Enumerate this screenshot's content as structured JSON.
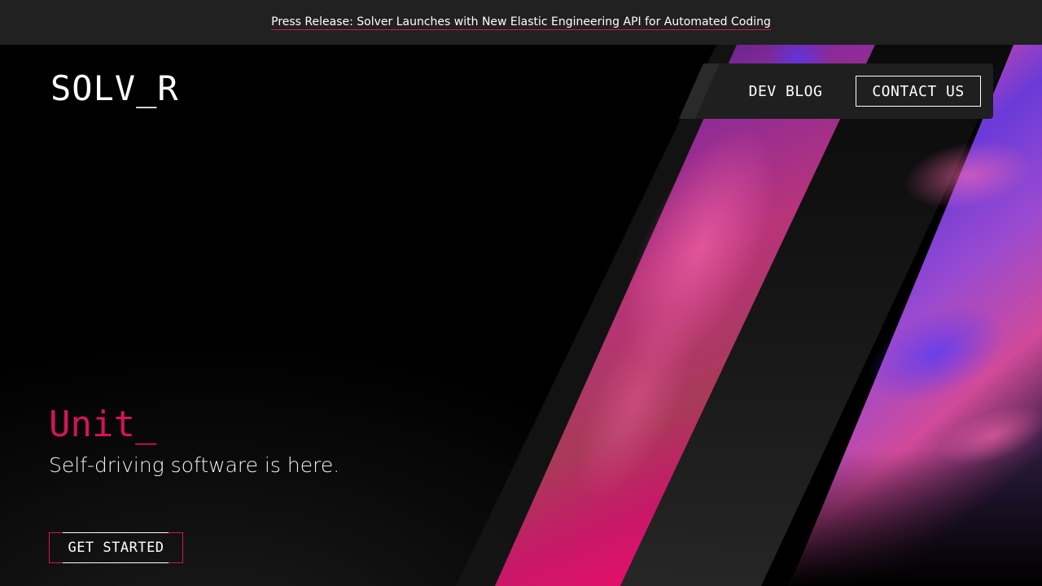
{
  "announcement": {
    "text": "Press Release: Solver Launches with New Elastic Engineering API for Automated Coding"
  },
  "brand": {
    "logo": "SOLV_R",
    "accent_color": "#d4145a"
  },
  "nav": {
    "blog_label": "DEV BLOG",
    "contact_label": "CONTACT US"
  },
  "hero": {
    "title": "Unit_",
    "subtitle": "Self-driving software is here.",
    "cta_label": "GET STARTED"
  }
}
